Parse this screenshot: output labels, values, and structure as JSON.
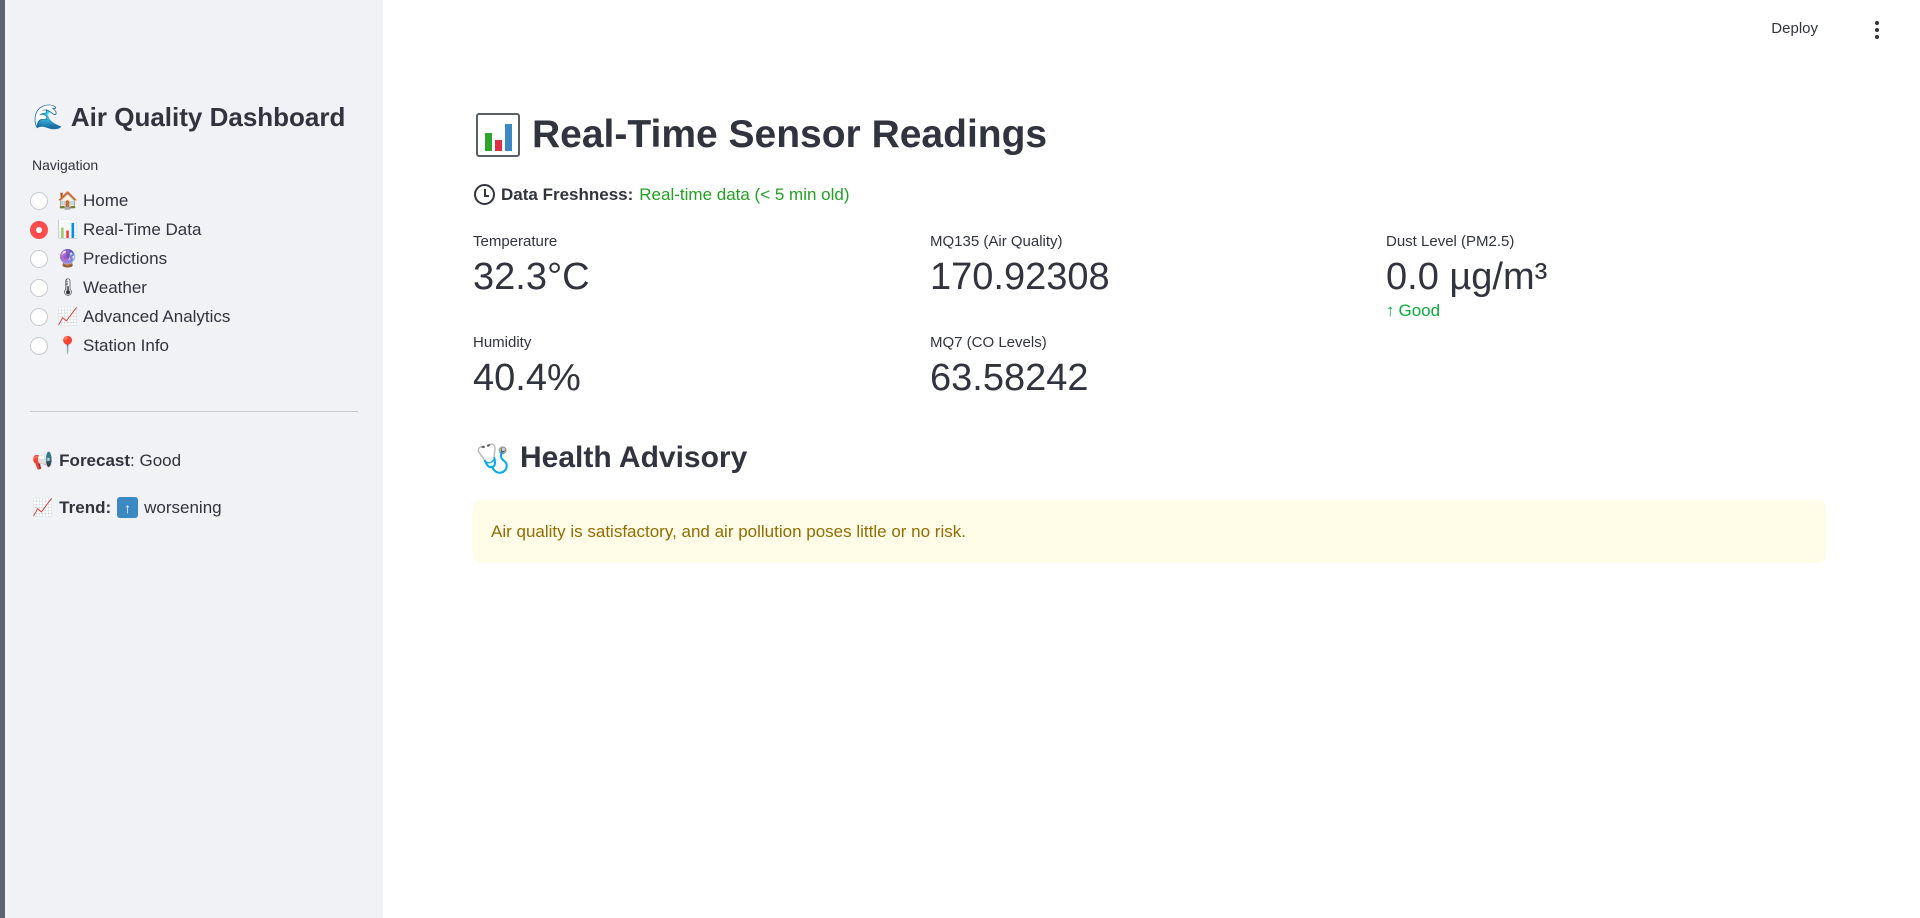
{
  "sidebar": {
    "title": "Air Quality Dashboard",
    "title_icon": "waves-icon",
    "nav_label": "Navigation",
    "nav_items": [
      {
        "label": "Home",
        "icon": "🏠",
        "icon_name": "house-icon",
        "selected": false
      },
      {
        "label": "Real-Time Data",
        "icon": "📊",
        "icon_name": "bar-chart-icon",
        "selected": true
      },
      {
        "label": "Predictions",
        "icon": "🔮",
        "icon_name": "crystal-ball-icon",
        "selected": false
      },
      {
        "label": "Weather",
        "icon": "🌡",
        "icon_name": "thermometer-icon",
        "selected": false
      },
      {
        "label": "Advanced Analytics",
        "icon": "📈",
        "icon_name": "trend-chart-icon",
        "selected": false
      },
      {
        "label": "Station Info",
        "icon": "📍",
        "icon_name": "pin-icon",
        "selected": false
      }
    ],
    "forecast_label": "Forecast",
    "forecast_value": "Good",
    "trend_label": "Trend:",
    "trend_arrow": "↑",
    "trend_value": "worsening"
  },
  "header": {
    "deploy_label": "Deploy"
  },
  "main": {
    "title": "Real-Time Sensor Readings",
    "freshness_label": "Data Freshness:",
    "freshness_value": "Real-time data (< 5 min old)",
    "metrics": [
      {
        "label": "Temperature",
        "value": "32.3°C"
      },
      {
        "label": "MQ135 (Air Quality)",
        "value": "170.92308"
      },
      {
        "label": "Dust Level (PM2.5)",
        "value": "0.0 µg/m³",
        "delta": "Good"
      },
      {
        "label": "Humidity",
        "value": "40.4%"
      },
      {
        "label": "MQ7 (CO Levels)",
        "value": "63.58242"
      }
    ],
    "advisory_title": "Health Advisory",
    "advisory_text": "Air quality is satisfactory, and air pollution poses little or no risk."
  },
  "colors": {
    "accent": "#ff4b4b",
    "freshness_green": "#21a121",
    "delta_green": "#09ab3b",
    "advisory_bg": "#fffce7",
    "advisory_text": "#926c05",
    "sidebar_bg": "#f0f2f6"
  }
}
